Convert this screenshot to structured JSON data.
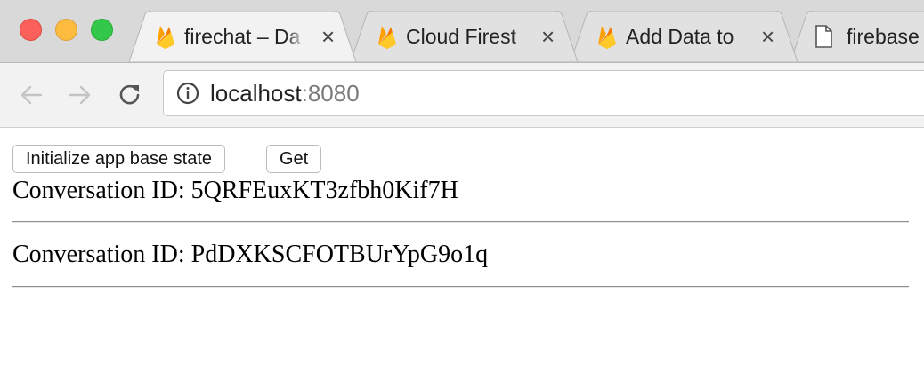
{
  "browser": {
    "tabs": [
      {
        "title": "firechat – Da",
        "favicon": "firebase-icon"
      },
      {
        "title": "Cloud Firest",
        "favicon": "firebase-icon"
      },
      {
        "title": "Add Data to",
        "favicon": "firebase-icon"
      },
      {
        "title": "firebase",
        "favicon": "document-icon"
      }
    ],
    "address": {
      "host": "localhost",
      "port": ":8080"
    }
  },
  "page": {
    "buttons": {
      "init_label": "Initialize app base state",
      "get_label": "Get"
    },
    "conversations": [
      {
        "label": "Conversation ID: 5QRFEuxKT3zfbh0Kif7H"
      },
      {
        "label": "Conversation ID: PdDXKSCFOTBUrYpG9o1q"
      }
    ]
  }
}
